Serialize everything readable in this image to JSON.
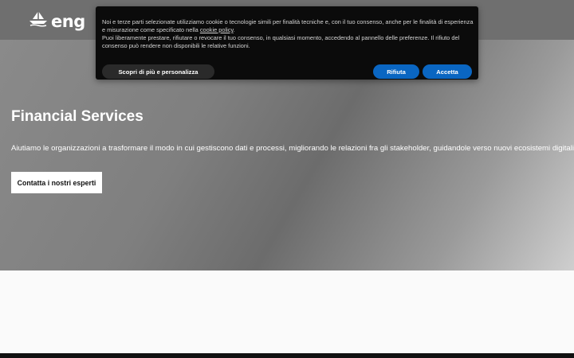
{
  "header": {
    "logo_text": "eng",
    "logo_icon": "ship-icon"
  },
  "hero": {
    "title": "Financial Services",
    "description": "Aiutiamo le organizzazioni a trasformare il modo in cui gestiscono dati e processi, migliorando le relazioni fra gli stakeholder, guidandole verso nuovi ecosistemi digitali.",
    "cta_label": "Contatta i nostri esperti"
  },
  "cookie_banner": {
    "text_part1": "Noi e terze parti selezionate utilizziamo cookie o tecnologie simili per finalità tecniche e, con il tuo consenso, anche per le finalità di esperienza e misurazione come specificato nella ",
    "policy_link": "cookie policy",
    "text_part2": ".",
    "text_part3": "Puoi liberamente prestare, rifiutare o revocare il tuo consenso, in qualsiasi momento, accedendo al pannello delle preferenze. Il rifiuto del consenso può rendere non disponibili le relative funzioni.",
    "learn_more_label": "Scopri di più e personalizza",
    "reject_label": "Rifiuta",
    "accept_label": "Accetta"
  },
  "colors": {
    "accent_blue": "#0a66c2",
    "banner_bg": "#0b0b0b",
    "header_bg": "#6f6f6f"
  }
}
